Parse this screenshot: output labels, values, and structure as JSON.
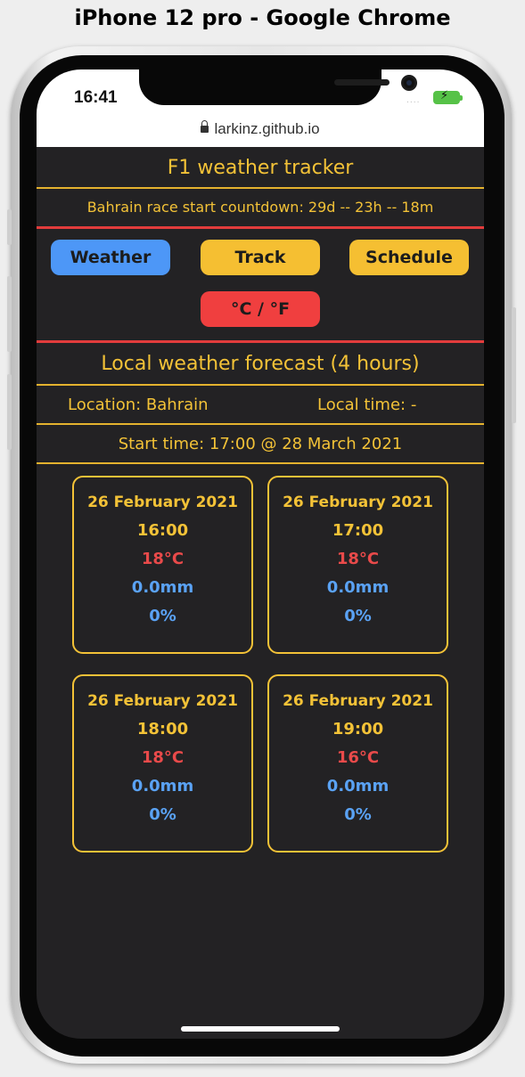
{
  "window": {
    "title": "iPhone 12 pro - Google Chrome"
  },
  "status_bar": {
    "time": "16:41",
    "signal": "....",
    "battery_icon": "battery-charging-icon"
  },
  "browser": {
    "url": "larkinz.github.io"
  },
  "app": {
    "title": "F1 weather tracker",
    "countdown": "Bahrain race start countdown: 29d -- 23h -- 18m",
    "nav": {
      "weather": "Weather",
      "track": "Track",
      "schedule": "Schedule"
    },
    "unit_toggle": "°C / °F"
  },
  "forecast": {
    "title": "Local weather forecast (4 hours)",
    "location": "Location: Bahrain",
    "local_time": "Local time: -",
    "start_time": "Start time: 17:00 @ 28 March 2021",
    "cards": [
      {
        "date": "26 February 2021",
        "time": "16:00",
        "temp": "18°C",
        "rain": "0.0mm",
        "chance": "0%"
      },
      {
        "date": "26 February 2021",
        "time": "17:00",
        "temp": "18°C",
        "rain": "0.0mm",
        "chance": "0%"
      },
      {
        "date": "26 February 2021",
        "time": "18:00",
        "temp": "18°C",
        "rain": "0.0mm",
        "chance": "0%"
      },
      {
        "date": "26 February 2021",
        "time": "19:00",
        "temp": "16°C",
        "rain": "0.0mm",
        "chance": "0%"
      }
    ]
  },
  "colors": {
    "accent_yellow": "#f3c237",
    "accent_blue": "#4d97f7",
    "accent_red": "#f03f3f",
    "background": "#232224"
  }
}
